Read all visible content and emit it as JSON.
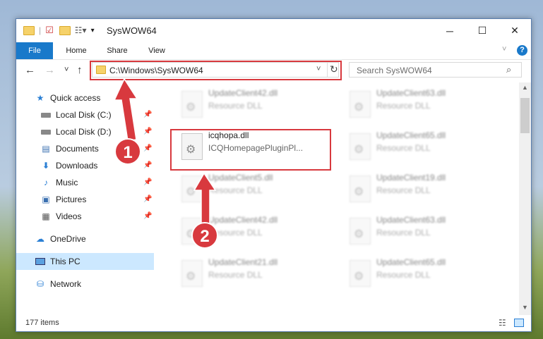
{
  "window": {
    "title": "SysWOW64",
    "controls": {
      "minimize": "─",
      "maximize": "☐",
      "close": "✕"
    }
  },
  "ribbon": {
    "tabs": [
      "File",
      "Home",
      "Share",
      "View"
    ],
    "help_icon": "?"
  },
  "navigation": {
    "back": "←",
    "forward": "→",
    "recent": "˅",
    "up": "↑",
    "address": "C:\\Windows\\SysWOW64",
    "refresh": "↻",
    "search_placeholder": "Search SysWOW64"
  },
  "sidebar": {
    "items": [
      {
        "label": "Quick access",
        "icon": "star-icon"
      },
      {
        "label": "Local Disk (C:)",
        "icon": "drive-icon"
      },
      {
        "label": "Local Disk (D:)",
        "icon": "drive-icon"
      },
      {
        "label": "Documents",
        "icon": "documents-icon"
      },
      {
        "label": "Downloads",
        "icon": "download-icon"
      },
      {
        "label": "Music",
        "icon": "music-icon"
      },
      {
        "label": "Pictures",
        "icon": "pictures-icon"
      },
      {
        "label": "Videos",
        "icon": "videos-icon"
      },
      {
        "label": "OneDrive",
        "icon": "cloud-icon"
      },
      {
        "label": "This PC",
        "icon": "computer-icon"
      },
      {
        "label": "Network",
        "icon": "network-icon"
      }
    ]
  },
  "files": [
    {
      "name": "UpdateClient42.dll",
      "desc": "Resource DLL"
    },
    {
      "name": "UpdateClient63.dll",
      "desc": "Resource DLL"
    },
    {
      "name": "icqhopa.dll",
      "desc": "ICQHomepagePluginPl..."
    },
    {
      "name": "UpdateClient65.dll",
      "desc": "Resource DLL"
    },
    {
      "name": "UpdateClient5.dll",
      "desc": "Resource DLL"
    },
    {
      "name": "UpdateClient19.dll",
      "desc": "Resource DLL"
    },
    {
      "name": "UpdateClient42.dll",
      "desc": "Resource DLL"
    },
    {
      "name": "UpdateClient63.dll",
      "desc": "Resource DLL"
    },
    {
      "name": "UpdateClient21.dll",
      "desc": "Resource DLL"
    },
    {
      "name": "UpdateClient65.dll",
      "desc": "Resource DLL"
    }
  ],
  "status": {
    "item_count": "177 items"
  },
  "annotations": {
    "step1": "1",
    "step2": "2",
    "color": "#d8393e"
  }
}
